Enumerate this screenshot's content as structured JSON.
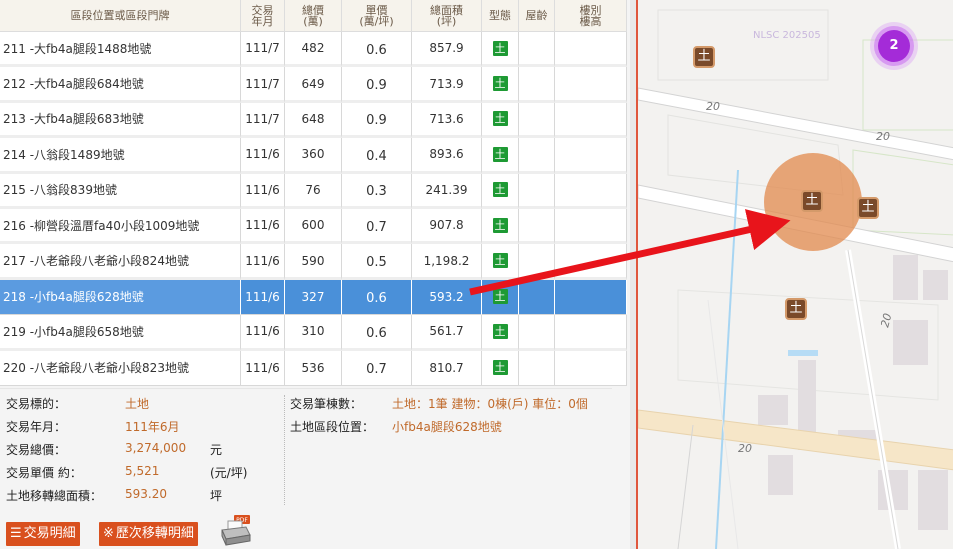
{
  "table": {
    "headers": {
      "address": "區段位置或區段門牌",
      "date": "交易\n年月",
      "total": "總價\n(萬)",
      "unit": "單價\n(萬/坪)",
      "area": "總面積\n(坪)",
      "type": "型態",
      "age": "屋齡",
      "floor": "樓別\n樓高"
    },
    "rows": [
      {
        "address": "211 -大fb4a腿段1488地號",
        "date": "111/7",
        "total": "482",
        "unit": "0.6",
        "area": "857.9",
        "type": "土",
        "age": "",
        "floor": ""
      },
      {
        "address": "212 -大fb4a腿段684地號",
        "date": "111/7",
        "total": "649",
        "unit": "0.9",
        "area": "713.9",
        "type": "土",
        "age": "",
        "floor": ""
      },
      {
        "address": "213 -大fb4a腿段683地號",
        "date": "111/7",
        "total": "648",
        "unit": "0.9",
        "area": "713.6",
        "type": "土",
        "age": "",
        "floor": ""
      },
      {
        "address": "214 -八翁段1489地號",
        "date": "111/6",
        "total": "360",
        "unit": "0.4",
        "area": "893.6",
        "type": "土",
        "age": "",
        "floor": ""
      },
      {
        "address": "215 -八翁段839地號",
        "date": "111/6",
        "total": "76",
        "unit": "0.3",
        "area": "241.39",
        "type": "土",
        "age": "",
        "floor": ""
      },
      {
        "address": "216 -柳營段溫厝fa40小段1009地號",
        "date": "111/6",
        "total": "600",
        "unit": "0.7",
        "area": "907.8",
        "type": "土",
        "age": "",
        "floor": ""
      },
      {
        "address": "217 -八老爺段八老爺小段824地號",
        "date": "111/6",
        "total": "590",
        "unit": "0.5",
        "area": "1,198.2",
        "type": "土",
        "age": "",
        "floor": ""
      },
      {
        "address": "218 -小fb4a腿段628地號",
        "date": "111/6",
        "total": "327",
        "unit": "0.6",
        "area": "593.2",
        "type": "土",
        "age": "",
        "floor": ""
      },
      {
        "address": "219 -小fb4a腿段658地號",
        "date": "111/6",
        "total": "310",
        "unit": "0.6",
        "area": "561.7",
        "type": "土",
        "age": "",
        "floor": ""
      },
      {
        "address": "220 -八老爺段八老爺小段823地號",
        "date": "111/6",
        "total": "536",
        "unit": "0.7",
        "area": "810.7",
        "type": "土",
        "age": "",
        "floor": ""
      }
    ],
    "selected_index": 7
  },
  "detail": {
    "target_label": "交易標的：",
    "target_value": "土地",
    "date_label": "交易年月：",
    "date_value": "111年6月",
    "total_label": "交易總價：",
    "total_value": "3,274,000",
    "total_unit": "元",
    "unit_label": "交易單價 約：",
    "unit_value": "5,521",
    "unit_unit": "(元/坪)",
    "area_label": "土地移轉總面積：",
    "area_value": "593.20",
    "area_unit": "坪",
    "count_label": "交易筆棟數：",
    "count_value": "土地：1筆 建物：0棟(戶) 車位：0個",
    "location_label": "土地區段位置：",
    "location_value": "小fb4a腿段628地號"
  },
  "buttons": {
    "detail_icon": "☰",
    "detail_label": "交易明細",
    "history_icon": "※",
    "history_label": "歷次移轉明細",
    "pdf_badge": "PDF"
  },
  "map": {
    "watermark": "NLSC 202505",
    "cluster_count": "2",
    "marker_glyph": "土",
    "road_label": "20",
    "icons": [
      "land-marker-icon",
      "cluster-icon",
      "pdf-printer-icon",
      "list-icon"
    ]
  },
  "colors": {
    "selected_row": "#4a90d9",
    "accent_orange": "#d9501e",
    "land_badge": "#1e9a34",
    "value_text": "#c06a2b",
    "cluster": "#a42bd8",
    "arrow": "#e8141b"
  }
}
